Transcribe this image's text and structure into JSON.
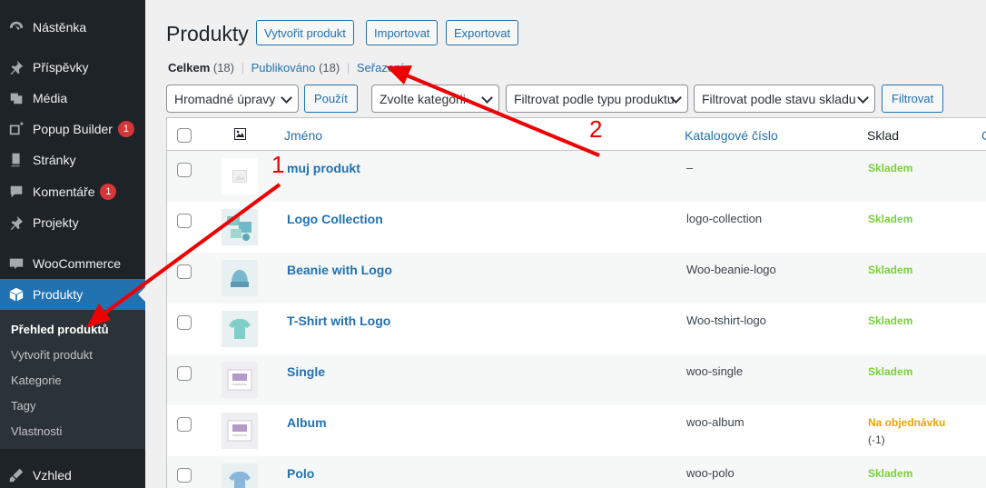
{
  "sidebar": {
    "items": [
      {
        "label": "Nástěnka",
        "icon": "dashboard-icon"
      },
      {
        "label": "Příspěvky",
        "icon": "pin-icon"
      },
      {
        "label": "Média",
        "icon": "media-icon"
      },
      {
        "label": "Popup Builder",
        "icon": "popup-icon",
        "badge": "1"
      },
      {
        "label": "Stránky",
        "icon": "pages-icon"
      },
      {
        "label": "Komentáře",
        "icon": "comments-icon",
        "badge": "1"
      },
      {
        "label": "Projekty",
        "icon": "pin-icon"
      },
      {
        "label": "WooCommerce",
        "icon": "woo-icon"
      },
      {
        "label": "Produkty",
        "icon": "products-icon"
      },
      {
        "label": "Vzhled",
        "icon": "appearance-icon"
      }
    ],
    "submenu": [
      "Přehled produktů",
      "Vytvořit produkt",
      "Kategorie",
      "Tagy",
      "Vlastnosti"
    ]
  },
  "header": {
    "title": "Produkty",
    "buttons": [
      "Vytvořit produkt",
      "Importovat",
      "Exportovat"
    ]
  },
  "views": {
    "all_label": "Celkem",
    "all_count": "(18)",
    "published_label": "Publikováno",
    "published_count": "(18)",
    "sort_label": "Seřazení"
  },
  "filters": {
    "bulk": "Hromadné úpravy",
    "apply": "Použít",
    "category": "Zvolte kategorii",
    "type": "Filtrovat podle typu produktu",
    "stock": "Filtrovat podle stavu skladu",
    "filter_btn": "Filtrovat"
  },
  "table": {
    "col_name": "Jméno",
    "col_sku": "Katalogové číslo",
    "col_stock": "Sklad",
    "col_extra": "C",
    "rows": [
      {
        "name": "muj produkt",
        "sku": "–",
        "stock": "Skladem",
        "status": "in"
      },
      {
        "name": "Logo Collection",
        "sku": "logo-collection",
        "stock": "Skladem",
        "status": "in"
      },
      {
        "name": "Beanie with Logo",
        "sku": "Woo-beanie-logo",
        "stock": "Skladem",
        "status": "in"
      },
      {
        "name": "T-Shirt with Logo",
        "sku": "Woo-tshirt-logo",
        "stock": "Skladem",
        "status": "in"
      },
      {
        "name": "Single",
        "sku": "woo-single",
        "stock": "Skladem",
        "status": "in"
      },
      {
        "name": "Album",
        "sku": "woo-album",
        "stock": "Na objednávku",
        "note": "(-1)",
        "status": "backorder"
      },
      {
        "name": "Polo",
        "sku": "woo-polo",
        "stock": "Skladem",
        "status": "in"
      }
    ]
  },
  "annotations": {
    "one": "1",
    "two": "2"
  },
  "colors": {
    "accent": "#2271b1",
    "sidebar": "#1d2327",
    "instock": "#7ad03a",
    "backorder": "#eaa600",
    "arrow": "#ee0000"
  }
}
